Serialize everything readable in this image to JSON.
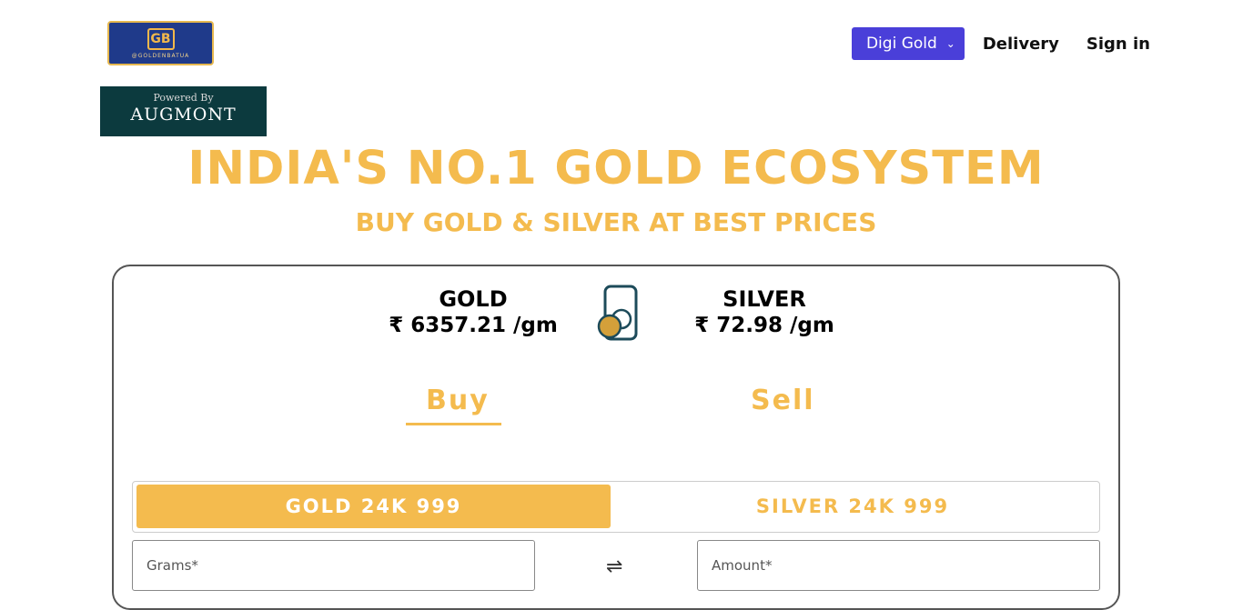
{
  "brand": {
    "logo_text": "@GOLDENBATUA",
    "logo_mark": "GB"
  },
  "nav": {
    "digi_gold": "Digi Gold",
    "delivery": "Delivery",
    "sign_in": "Sign in"
  },
  "partner": {
    "powered_by": "Powered By",
    "name": "AUGMONT"
  },
  "hero": {
    "headline": "INDIA'S NO.1 GOLD ECOSYSTEM",
    "subheadline": "BUY GOLD & SILVER AT BEST PRICES"
  },
  "prices": {
    "gold_label": "GOLD",
    "gold_price": "₹ 6357.21 /gm",
    "silver_label": "SILVER",
    "silver_price": "₹ 72.98 /gm"
  },
  "tabs": {
    "buy": "Buy",
    "sell": "Sell",
    "active": "Buy"
  },
  "metals": {
    "gold": "GOLD 24K 999",
    "silver": "SILVER 24K 999",
    "selected": "GOLD 24K 999"
  },
  "form": {
    "grams_placeholder": "Grams*",
    "amount_placeholder": "Amount*",
    "grams_value": "",
    "amount_value": ""
  },
  "icons": {
    "swap": "swap-arrows-icon",
    "coin": "coin-phone-icon"
  },
  "colors": {
    "accent": "#f4bb4e",
    "nav_button": "#4a3fd9",
    "partner_bg": "#0c3a3e"
  }
}
